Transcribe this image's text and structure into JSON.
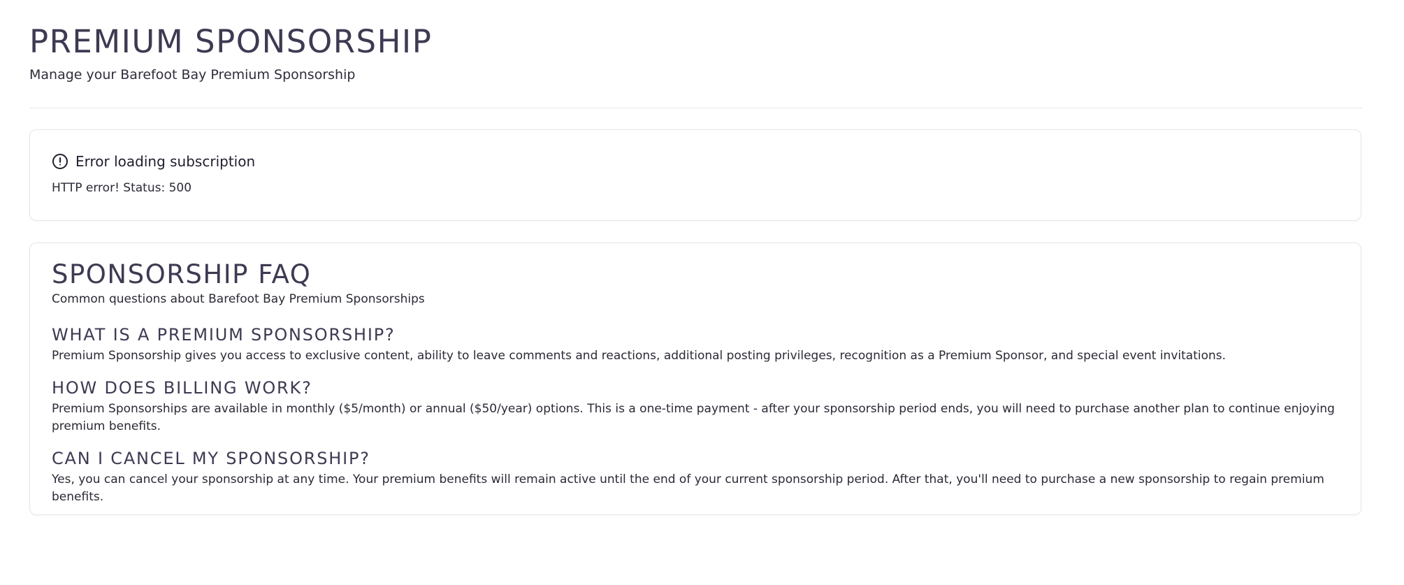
{
  "header": {
    "title": "Premium Sponsorship",
    "subtitle": "Manage your Barefoot Bay Premium Sponsorship"
  },
  "error": {
    "icon": "alert-circle-icon",
    "title": "Error loading subscription",
    "detail": "HTTP error! Status: 500"
  },
  "faq": {
    "title": "Sponsorship FAQ",
    "subtitle": "Common questions about Barefoot Bay Premium Sponsorships",
    "items": [
      {
        "question": "What is a Premium Sponsorship?",
        "answer": "Premium Sponsorship gives you access to exclusive content, ability to leave comments and reactions, additional posting privileges, recognition as a Premium Sponsor, and special event invitations."
      },
      {
        "question": "How does billing work?",
        "answer": "Premium Sponsorships are available in monthly ($5/month) or annual ($50/year) options. This is a one-time payment - after your sponsorship period ends, you will need to purchase another plan to continue enjoying premium benefits."
      },
      {
        "question": "Can I cancel my sponsorship?",
        "answer": "Yes, you can cancel your sponsorship at any time. Your premium benefits will remain active until the end of your current sponsorship period. After that, you'll need to purchase a new sponsorship to regain premium benefits."
      }
    ]
  },
  "colors": {
    "heading": "#3d3a52",
    "text": "#2a2a36",
    "border": "#e6e6ea"
  }
}
